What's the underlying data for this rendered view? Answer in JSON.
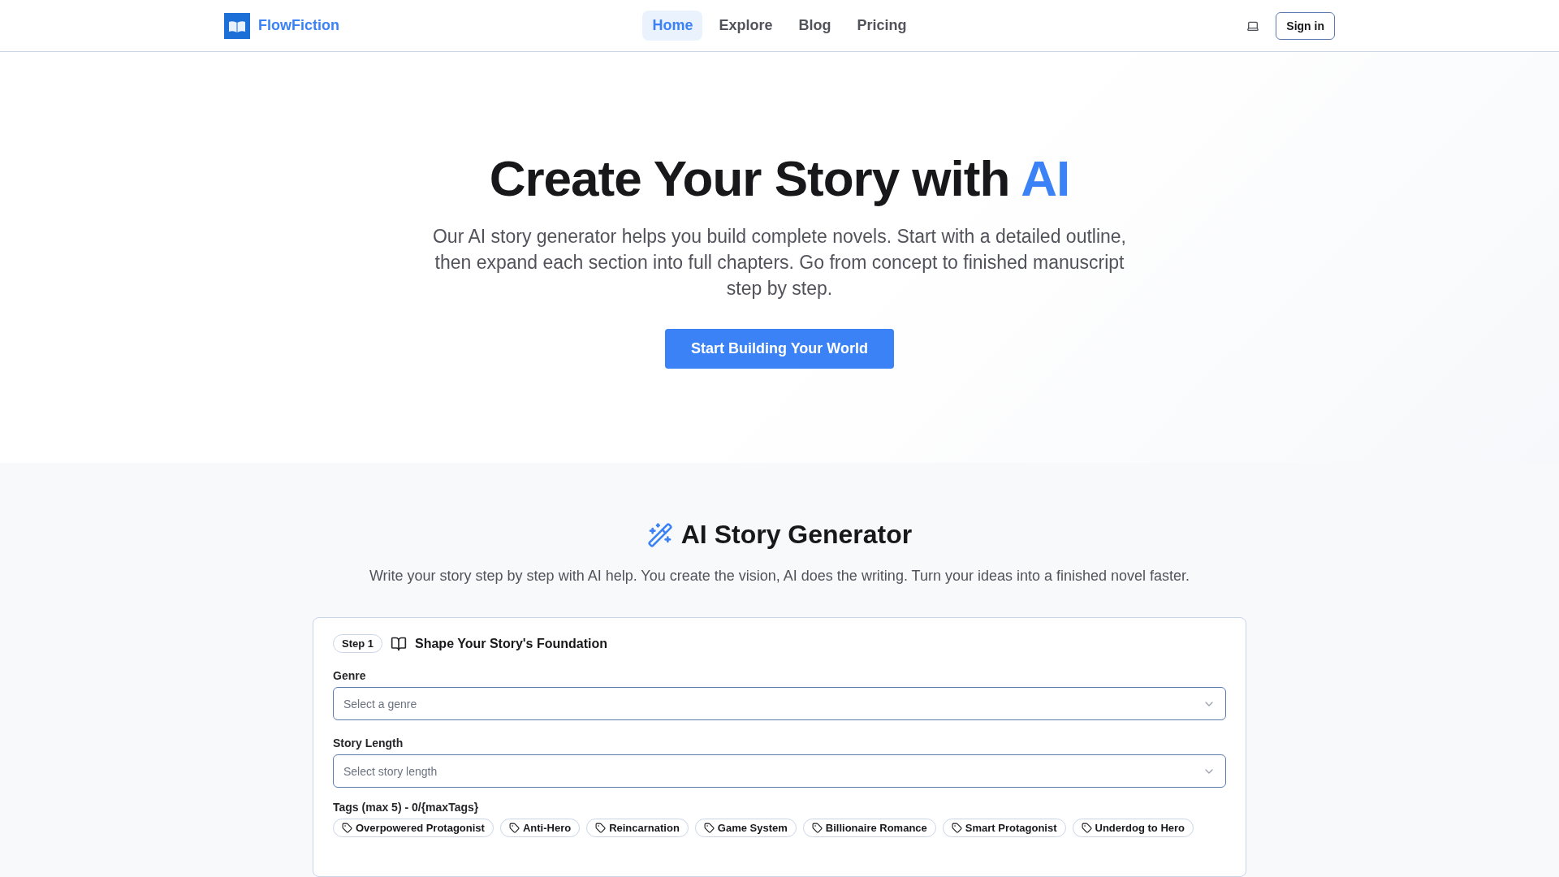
{
  "header": {
    "brand": "FlowFiction",
    "nav": [
      {
        "label": "Home",
        "selected": true
      },
      {
        "label": "Explore",
        "selected": false
      },
      {
        "label": "Blog",
        "selected": false
      },
      {
        "label": "Pricing",
        "selected": false
      }
    ],
    "sign_in": "Sign in"
  },
  "hero": {
    "title": "Create Your Story with",
    "title_highlight": "AI",
    "subtitle": "Our AI story generator helps you build complete novels. Start with a detailed outline, then expand each section into full chapters. Go from concept to finished manuscript step by step.",
    "cta": "Start Building Your World"
  },
  "generator": {
    "title": "AI Story Generator",
    "subtitle": "Write your story step by step with AI help. You create the vision, AI does the writing. Turn your ideas into a finished novel faster.",
    "step": {
      "badge": "Step 1",
      "title": "Shape Your Story's Foundation"
    },
    "fields": [
      {
        "label": "Genre",
        "placeholder": "Select a genre"
      },
      {
        "label": "Story Length",
        "placeholder": "Select story length"
      }
    ],
    "tags_label": "Tags (max 5) - 0/{maxTags}",
    "tags": [
      "Overpowered Protagonist",
      "Anti-Hero",
      "Reincarnation",
      "Game System",
      "Billionaire Romance",
      "Smart Protagonist",
      "Underdog to Hero"
    ]
  }
}
